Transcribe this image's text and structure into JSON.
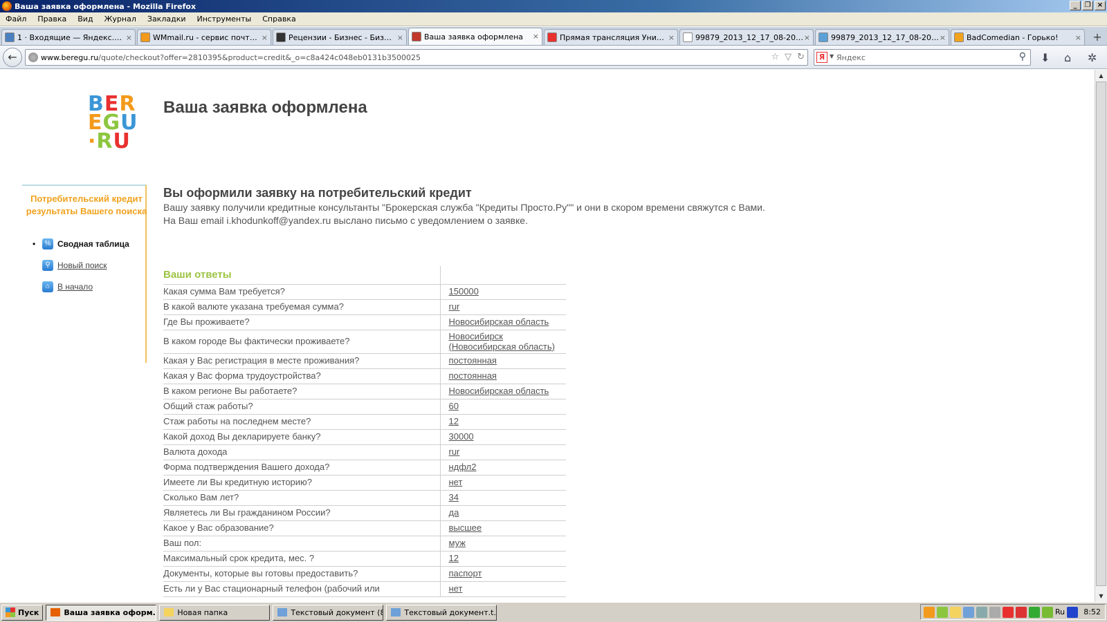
{
  "window": {
    "title": "Ваша заявка оформлена - Mozilla Firefox",
    "controls": [
      "_",
      "❐",
      "×"
    ]
  },
  "menu": [
    "Файл",
    "Правка",
    "Вид",
    "Журнал",
    "Закладки",
    "Инструменты",
    "Справка"
  ],
  "tabs": [
    {
      "label": "1 · Входящие — Яндекс.Поч...",
      "icon_color": "#4a7fc0",
      "icon": "mail-icon"
    },
    {
      "label": "WMmail.ru - сервис почтовы...",
      "icon_color": "#f39a1c",
      "icon": "wmmail-icon"
    },
    {
      "label": "Рецензии - Бизнес - Бизнес и...",
      "icon_color": "#333333",
      "icon": "review-icon"
    },
    {
      "label": "Ваша заявка оформлена",
      "icon_color": "#c0392b",
      "icon": "beregu-icon",
      "active": true
    },
    {
      "label": "Прямая трансляция Унив. К...",
      "icon_color": "#e8312f",
      "icon": "live-icon"
    },
    {
      "label": "99879_2013_12_17_08-20-4...",
      "icon_color": "#ffffff",
      "icon": "blank-page-icon"
    },
    {
      "label": "99879_2013_12_17_08-20-4...",
      "icon_color": "#5ca0d8",
      "icon": "image-icon"
    },
    {
      "label": "BadComedian - Горько!",
      "icon_color": "#f1a31d",
      "icon": "smiley-icon"
    }
  ],
  "nav": {
    "url_host": "www.beregu.ru",
    "url_path": "/quote/checkout?offer=2810395&product=credit&_o=c8a424c048eb0131b3500025",
    "search_placeholder": "Яндекс",
    "search_engine_glyph": "Я"
  },
  "page": {
    "title": "Ваша заявка оформлена",
    "logo": {
      "line1": [
        "B",
        "E",
        "R"
      ],
      "line2": [
        "E",
        "G",
        "U"
      ],
      "line3": [
        "·",
        "R",
        "U"
      ]
    },
    "sidebar": {
      "title": "Потребительский кредит результаты Вашего поиска",
      "items": [
        {
          "label": "Сводная таблица",
          "icon": "percent-icon",
          "glyph": "%",
          "current": true
        },
        {
          "label": "Новый поиск",
          "icon": "search-icon",
          "glyph": "🔍"
        },
        {
          "label": "В начало",
          "icon": "home-icon",
          "glyph": "⌂"
        }
      ]
    },
    "heading": "Вы оформили заявку на потребительский кредит",
    "message_line1": "Вашу заявку получили кредитные консультанты \"Брокерская служба \"Кредиты Просто.Ру\"\" и они в скором времени свяжутся с Вами.",
    "message_line2": "На Ваш email i.khodunkoff@yandex.ru выслано письмо с уведомлением о заявке.",
    "answers_header": "Ваши ответы",
    "answers": [
      {
        "q": "Какая сумма Вам требуется?",
        "a": "150000"
      },
      {
        "q": "В какой валюте указана требуемая сумма?",
        "a": "rur"
      },
      {
        "q": "Где Вы проживаете?",
        "a": "Новосибирская область"
      },
      {
        "q": "В каком городе Вы фактически проживаете?",
        "a": "Новосибирск (Новосибирская область)"
      },
      {
        "q": "Какая у Вас регистрация в месте проживания?",
        "a": "постоянная"
      },
      {
        "q": "Какая у Вас форма трудоустройства?",
        "a": "постоянная"
      },
      {
        "q": "В каком регионе Вы работаете?",
        "a": "Новосибирская область"
      },
      {
        "q": "Общий стаж работы?",
        "a": "60"
      },
      {
        "q": "Стаж работы на последнем месте?",
        "a": "12"
      },
      {
        "q": "Какой доход Вы декларируете банку?",
        "a": "30000"
      },
      {
        "q": "Валюта дохода",
        "a": "rur"
      },
      {
        "q": "Форма подтверждения Вашего дохода?",
        "a": "ндфл2"
      },
      {
        "q": "Имеете ли Вы кредитную историю?",
        "a": "нет"
      },
      {
        "q": "Сколько Вам лет?",
        "a": "34"
      },
      {
        "q": "Являетесь ли Вы гражданином России?",
        "a": "да"
      },
      {
        "q": "Какое у Вас образование?",
        "a": "высшее"
      },
      {
        "q": "Ваш пол:",
        "a": "муж"
      },
      {
        "q": "Максимальный срок кредита, мес. ?",
        "a": "12"
      },
      {
        "q": "Документы, которые вы готовы предоставить?",
        "a": "паспорт"
      },
      {
        "q": "Есть ли у Вас стационарный телефон (рабочий или",
        "a": "нет"
      }
    ]
  },
  "taskbar": {
    "start_label": "Пуск",
    "buttons": [
      {
        "label": "Ваша заявка оформ...",
        "icon": "firefox-icon",
        "icon_color": "#e66000",
        "pressed": true
      },
      {
        "label": "Новая папка",
        "icon": "folder-icon",
        "icon_color": "#f4d35e"
      },
      {
        "label": "Текстовый документ (8...",
        "icon": "notepad-icon",
        "icon_color": "#6fa0d8"
      },
      {
        "label": "Текстовый документ.t...",
        "icon": "notepad-icon",
        "icon_color": "#6fa0d8"
      }
    ],
    "lang": "Ru",
    "clock": "8:52"
  },
  "colors": {
    "accent_orange": "#f0a21d",
    "answers_green": "#9cc443",
    "logo_blue": "#3b96d6",
    "logo_red": "#e8312f",
    "logo_green": "#8cc63f"
  }
}
